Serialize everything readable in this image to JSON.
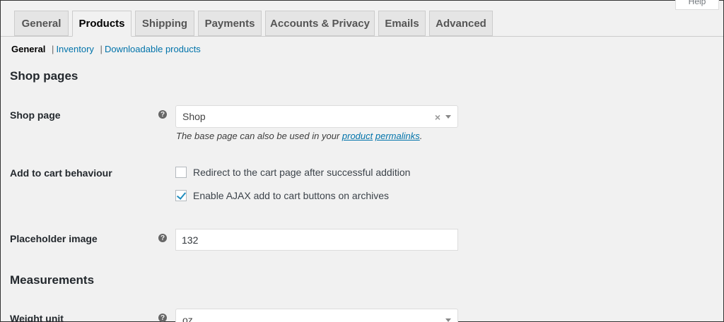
{
  "help_tab": {
    "label": "Help"
  },
  "tabs": [
    {
      "label": "General",
      "active": false
    },
    {
      "label": "Products",
      "active": true
    },
    {
      "label": "Shipping",
      "active": false
    },
    {
      "label": "Payments",
      "active": false
    },
    {
      "label": "Accounts & Privacy",
      "active": false
    },
    {
      "label": "Emails",
      "active": false
    },
    {
      "label": "Advanced",
      "active": false
    }
  ],
  "subnav": {
    "current": "General",
    "separator": "|",
    "links": [
      "Inventory",
      "Downloadable products"
    ]
  },
  "sections": {
    "shop_pages": "Shop pages",
    "measurements": "Measurements"
  },
  "shop_page": {
    "label": "Shop page",
    "tip": "?",
    "value": "Shop",
    "clear": "×",
    "desc_prefix": "The base page can also be used in your ",
    "desc_link1": "product",
    "desc_link2": "permalinks",
    "desc_suffix": "."
  },
  "add_to_cart": {
    "label": "Add to cart behaviour",
    "options": [
      {
        "label": "Redirect to the cart page after successful addition",
        "checked": false
      },
      {
        "label": "Enable AJAX add to cart buttons on archives",
        "checked": true
      }
    ]
  },
  "placeholder_image": {
    "label": "Placeholder image",
    "tip": "?",
    "value": "132"
  },
  "weight_unit": {
    "label": "Weight unit",
    "tip": "?",
    "value": "oz"
  },
  "colors": {
    "link": "#0073aa",
    "check": "#1e8cbe",
    "background": "#f1f1f1"
  }
}
